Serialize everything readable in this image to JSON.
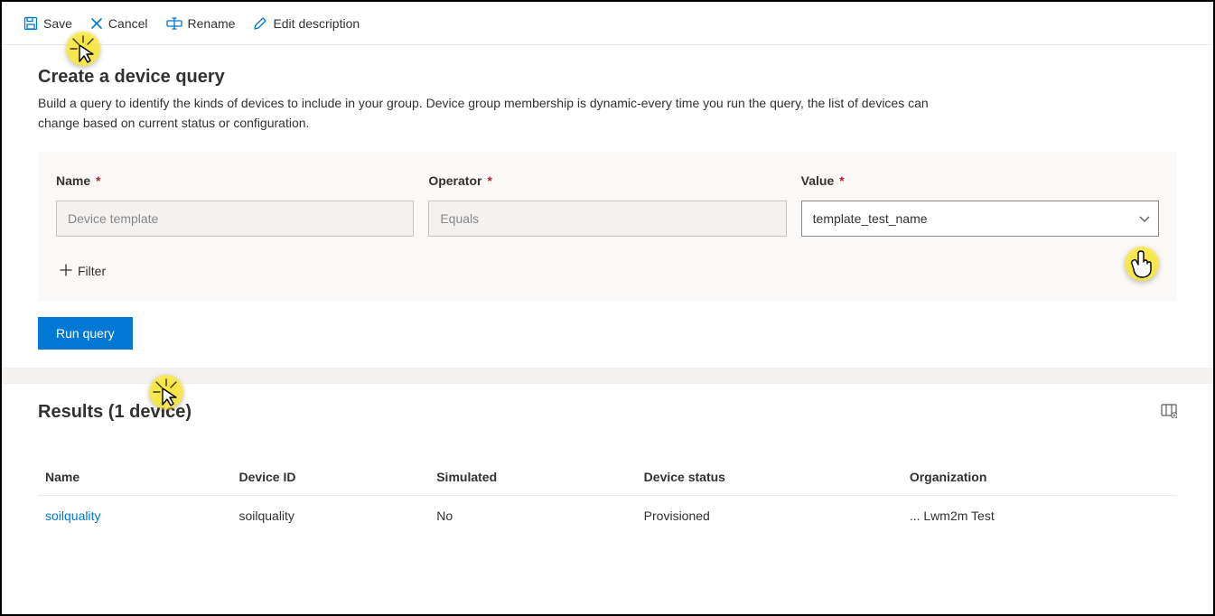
{
  "toolbar": {
    "save_label": "Save",
    "cancel_label": "Cancel",
    "rename_label": "Rename",
    "edit_description_label": "Edit description"
  },
  "page": {
    "title": "Create a device query",
    "description": "Build a query to identify the kinds of devices to include in your group. Device group membership is dynamic-every time you run the query, the list of devices can change based on current status or configuration."
  },
  "query": {
    "name_label": "Name",
    "operator_label": "Operator",
    "value_label": "Value",
    "name_placeholder": "Device template",
    "operator_placeholder": "Equals",
    "value_selected": "template_test_name",
    "add_filter_label": "Filter",
    "run_button": "Run query"
  },
  "results": {
    "title": "Results (1 device)",
    "columns": [
      "Name",
      "Device ID",
      "Simulated",
      "Device status",
      "Organization"
    ],
    "rows": [
      {
        "name": "soilquality",
        "device_id": "soilquality",
        "simulated": "No",
        "status": "Provisioned",
        "organization": "... Lwm2m Test"
      }
    ]
  }
}
